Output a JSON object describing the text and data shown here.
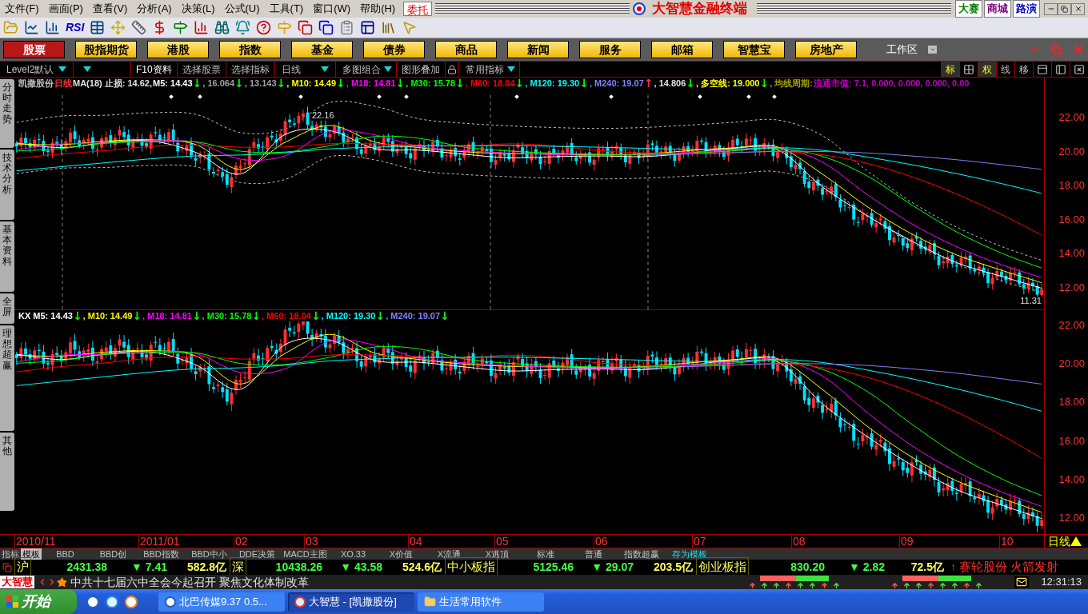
{
  "menu": [
    {
      "label": "文件(F)"
    },
    {
      "label": "画面(P)"
    },
    {
      "label": "查看(V)"
    },
    {
      "label": "分析(A)"
    },
    {
      "label": "决策(L)"
    },
    {
      "label": "公式(U)"
    },
    {
      "label": "工具(T)"
    },
    {
      "label": "窗口(W)"
    },
    {
      "label": "帮助(H)"
    }
  ],
  "trade_button": "委托",
  "app_title": "大智慧金融终端",
  "title_links": [
    {
      "label": "大赛",
      "color": "#008000"
    },
    {
      "label": "商城",
      "color": "#800080"
    },
    {
      "label": "路演",
      "color": "#0000c0"
    }
  ],
  "toolbar_rsi": "RSI",
  "nav_tabs": [
    {
      "label": "股票",
      "selected": true
    },
    {
      "label": "股指期货",
      "selected": false
    },
    {
      "label": "港股",
      "selected": false
    },
    {
      "label": "指数",
      "selected": false
    },
    {
      "label": "基金",
      "selected": false
    },
    {
      "label": "债券",
      "selected": false
    },
    {
      "label": "商品",
      "selected": false
    },
    {
      "label": "新闻",
      "selected": false
    },
    {
      "label": "服务",
      "selected": false
    },
    {
      "label": "邮箱",
      "selected": false
    },
    {
      "label": "智慧宝",
      "selected": false
    },
    {
      "label": "房地产",
      "selected": false
    }
  ],
  "workspace": "工作区",
  "chart_toolbar": [
    {
      "kind": "dropdown",
      "label": "Level2默认"
    },
    {
      "kind": "dropdown"
    },
    {
      "kind": "button",
      "label": "F10资料"
    },
    {
      "kind": "button",
      "label": "选择股票"
    },
    {
      "kind": "button",
      "label": "选择指标"
    },
    {
      "kind": "dropdown",
      "label": "日线"
    },
    {
      "kind": "dropdown",
      "label": "多图组合"
    },
    {
      "kind": "button",
      "label": "图形叠加"
    },
    {
      "kind": "lock"
    },
    {
      "kind": "dropdown",
      "label": "常用指标"
    }
  ],
  "chart_buttons": [
    {
      "kind": "text",
      "label": "标",
      "selected": true
    },
    {
      "kind": "grid"
    },
    {
      "kind": "text",
      "label": "权",
      "selected": true
    },
    {
      "kind": "text",
      "label": "线",
      "selected": false
    },
    {
      "kind": "text",
      "label": "移",
      "selected": false
    },
    {
      "kind": "top"
    },
    {
      "kind": "panel"
    },
    {
      "kind": "close"
    }
  ],
  "side_tabs": [
    "分时走势",
    "技术分析",
    "基本资料",
    "全屏",
    "理想超赢",
    "其他"
  ],
  "main_chart": {
    "legend": [
      {
        "text": "凯撒股份",
        "color": "#c0c0c0"
      },
      {
        "text": "日线",
        "color": "#ff3030"
      },
      {
        "text": "MA(18) 止损: 14.62,",
        "color": "#e0e0e0"
      },
      {
        "text": "M5: 14.43",
        "color": "#ffffff"
      },
      {
        "kind": "arrow",
        "text": "↓",
        "color": "#00ff00"
      },
      {
        "text": ", 16.064",
        "color": "#a0a0a0"
      },
      {
        "kind": "arrow",
        "text": "↓",
        "color": "#00ff00"
      },
      {
        "text": ", 13.143",
        "color": "#a0a0a0"
      },
      {
        "kind": "arrow",
        "text": "↓",
        "color": "#00ff00"
      },
      {
        "text": ", M10: 14.49",
        "color": "#ffff00"
      },
      {
        "kind": "arrow",
        "text": "↓",
        "color": "#00ff00"
      },
      {
        "text": ", M18: 14.81",
        "color": "#ff00ff"
      },
      {
        "kind": "arrow",
        "text": "↓",
        "color": "#00ff00"
      },
      {
        "text": ", M30: 15.78",
        "color": "#00ff00"
      },
      {
        "kind": "arrow",
        "text": "↓",
        "color": "#00ff00"
      },
      {
        "text": ", M60: 18.04",
        "color": "#ff0000"
      },
      {
        "kind": "arrow",
        "text": "↓",
        "color": "#00ff00"
      },
      {
        "text": ", M120: 19.30",
        "color": "#00ffff"
      },
      {
        "kind": "arrow",
        "text": "↓",
        "color": "#00ff00"
      },
      {
        "text": ", M240: 19.07",
        "color": "#8080ff"
      },
      {
        "kind": "arrow",
        "text": "↑",
        "color": "#ff3030"
      },
      {
        "text": ", 14.806",
        "color": "#e0e0e0"
      },
      {
        "kind": "arrow",
        "text": "↓",
        "color": "#00ff00"
      },
      {
        "text": ", 多空线: 19.000",
        "color": "#ffff00"
      },
      {
        "kind": "arrow",
        "text": "↓",
        "color": "#00ff00"
      },
      {
        "text": ", 均线周期:",
        "color": "#a0a000"
      },
      {
        "text": "流通市值: 7.1, 0.000, 0.000, 0.000, 0.00",
        "color": "#c000c0"
      }
    ],
    "yticks": [
      "22.00",
      "20.00",
      "18.00",
      "16.00",
      "14.00",
      "12.00"
    ],
    "high_label": "22.16",
    "low_label": "11.31"
  },
  "sub_chart": {
    "legend": [
      {
        "text": "KX M5: 14.43",
        "color": "#ffffff"
      },
      {
        "kind": "arrow",
        "text": "↓",
        "color": "#00ff00"
      },
      {
        "text": ", M10: 14.49",
        "color": "#ffff00"
      },
      {
        "kind": "arrow",
        "text": "↓",
        "color": "#00ff00"
      },
      {
        "text": ", M18: 14.81",
        "color": "#ff00ff"
      },
      {
        "kind": "arrow",
        "text": "↓",
        "color": "#00ff00"
      },
      {
        "text": ", M30: 15.78",
        "color": "#00ff00"
      },
      {
        "kind": "arrow",
        "text": "↓",
        "color": "#00ff00"
      },
      {
        "text": ", M60: 18.04",
        "color": "#ff0000"
      },
      {
        "kind": "arrow",
        "text": "↓",
        "color": "#00ff00"
      },
      {
        "text": ", M120: 19.30",
        "color": "#00ffff"
      },
      {
        "kind": "arrow",
        "text": "↓",
        "color": "#00ff00"
      },
      {
        "text": ", M240: 19.07",
        "color": "#8080ff"
      },
      {
        "kind": "arrow",
        "text": "↓",
        "color": "#00ff00"
      }
    ],
    "yticks": [
      "22.00",
      "20.00",
      "18.00",
      "16.00",
      "14.00",
      "12.00"
    ]
  },
  "x_labels": [
    "2010/11",
    "2011/01",
    "02",
    "03",
    "04",
    "05",
    "06",
    "07",
    "08",
    "09",
    "10"
  ],
  "period": "日线",
  "indicator_tabs": [
    {
      "label": "指标",
      "kind": "header",
      "selected": false
    },
    {
      "label": "模板",
      "kind": "header",
      "selected": true
    },
    {
      "label": "BBD",
      "kind": "tab",
      "selected": false
    },
    {
      "label": "BBD创",
      "kind": "tab",
      "selected": false
    },
    {
      "label": "BBD指数",
      "kind": "tab",
      "selected": false
    },
    {
      "label": "BBD中小",
      "kind": "tab",
      "selected": false
    },
    {
      "label": "DDE决策",
      "kind": "tab",
      "selected": false
    },
    {
      "label": "MACD主图",
      "kind": "tab",
      "selected": false
    },
    {
      "label": "XO.33",
      "kind": "tab",
      "selected": false
    },
    {
      "label": "X价值",
      "kind": "tab",
      "selected": false
    },
    {
      "label": "X流通",
      "kind": "tab",
      "selected": false
    },
    {
      "label": "X逃顶",
      "kind": "tab",
      "selected": false
    },
    {
      "label": "标准",
      "kind": "tab",
      "selected": false
    },
    {
      "label": "普通",
      "kind": "tab",
      "selected": false
    },
    {
      "label": "指数超赢",
      "kind": "tab",
      "selected": false
    },
    {
      "label": "存为模板",
      "kind": "action",
      "selected": false
    }
  ],
  "markets": [
    {
      "name": "沪",
      "value": "2431.38",
      "change": "▼ 7.41",
      "amount": "582.8亿"
    },
    {
      "name": "深",
      "value": "10438.26",
      "change": "▼ 43.58",
      "amount": "524.6亿"
    },
    {
      "name": "中小板指",
      "value": "5125.46",
      "change": "▼ 29.07",
      "amount": "203.5亿"
    },
    {
      "name": "创业板指",
      "value": "830.20",
      "change": "▼ 2.82",
      "amount": "72.5亿"
    }
  ],
  "alert": {
    "arrow": "↑",
    "text": "赛轮股份 火箭发射"
  },
  "ticker": {
    "logo": "大智慧",
    "headline": "中共十七届六中全会今起召开 聚焦文化体制改革"
  },
  "breadth": [
    {
      "level": 0.52
    },
    {
      "level": 0.52
    }
  ],
  "clock": "12:31:13",
  "taskbar": {
    "start": "开始",
    "tasks": [
      {
        "label": "北巴传媒9.37 0.5...",
        "selected": false
      },
      {
        "label": "大智慧 - [凯撒股份]",
        "selected": true
      },
      {
        "label": "生活常用软件",
        "selected": false
      }
    ]
  }
}
